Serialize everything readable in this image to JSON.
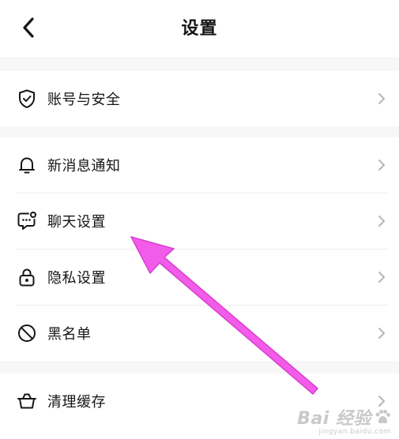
{
  "header": {
    "title": "设置",
    "back_icon": "chevron-left-icon"
  },
  "sections": [
    {
      "items": [
        {
          "label": "账号与安全",
          "icon": "shield-check-icon"
        }
      ]
    },
    {
      "items": [
        {
          "label": "新消息通知",
          "icon": "bell-icon"
        },
        {
          "label": "聊天设置",
          "icon": "chat-bubble-icon"
        },
        {
          "label": "隐私设置",
          "icon": "lock-icon"
        },
        {
          "label": "黑名单",
          "icon": "block-icon"
        }
      ]
    },
    {
      "items": [
        {
          "label": "清理缓存",
          "icon": "basket-icon"
        }
      ]
    }
  ],
  "colors": {
    "background": "#ffffff",
    "section_gap": "#f7f7f7",
    "text": "#161616",
    "chevron": "#b5b5b5",
    "annotation_arrow": "#f25ce8"
  },
  "watermark": {
    "brand": "Bai 经验",
    "url": "jingyan.baidu.com"
  }
}
